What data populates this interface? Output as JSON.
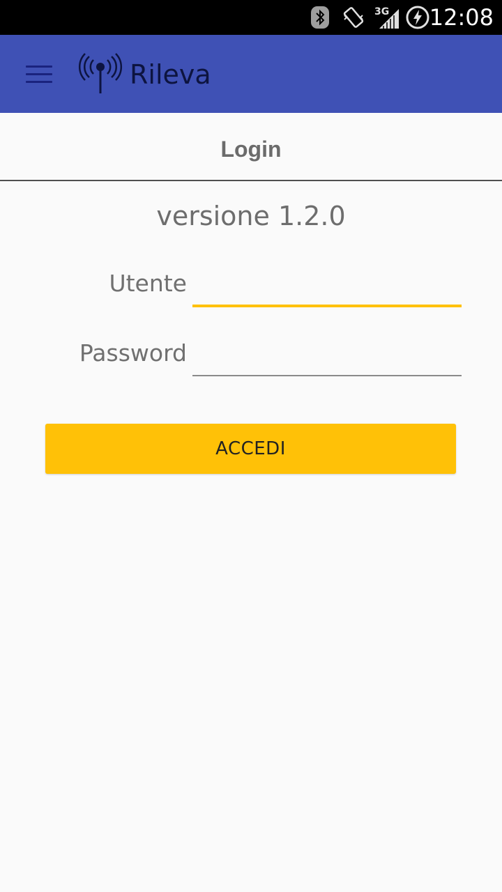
{
  "status_bar": {
    "time": "12:08",
    "network": "3G",
    "icons": [
      "bluetooth-icon",
      "vibrate-icon",
      "signal-3g-icon",
      "battery-charging-icon"
    ]
  },
  "app_bar": {
    "title": "Rileva",
    "menu_icon": "hamburger-menu-icon",
    "logo_icon": "antenna-broadcast-icon",
    "color": "#3f51b5"
  },
  "page": {
    "title": "Login",
    "version": "versione 1.2.0"
  },
  "form": {
    "username": {
      "label": "Utente",
      "value": "",
      "placeholder": ""
    },
    "password": {
      "label": "Password",
      "value": "",
      "placeholder": ""
    },
    "submit_label": "ACCEDI"
  },
  "colors": {
    "accent": "#ffc107",
    "primary": "#3f51b5",
    "background": "#fafafa"
  }
}
